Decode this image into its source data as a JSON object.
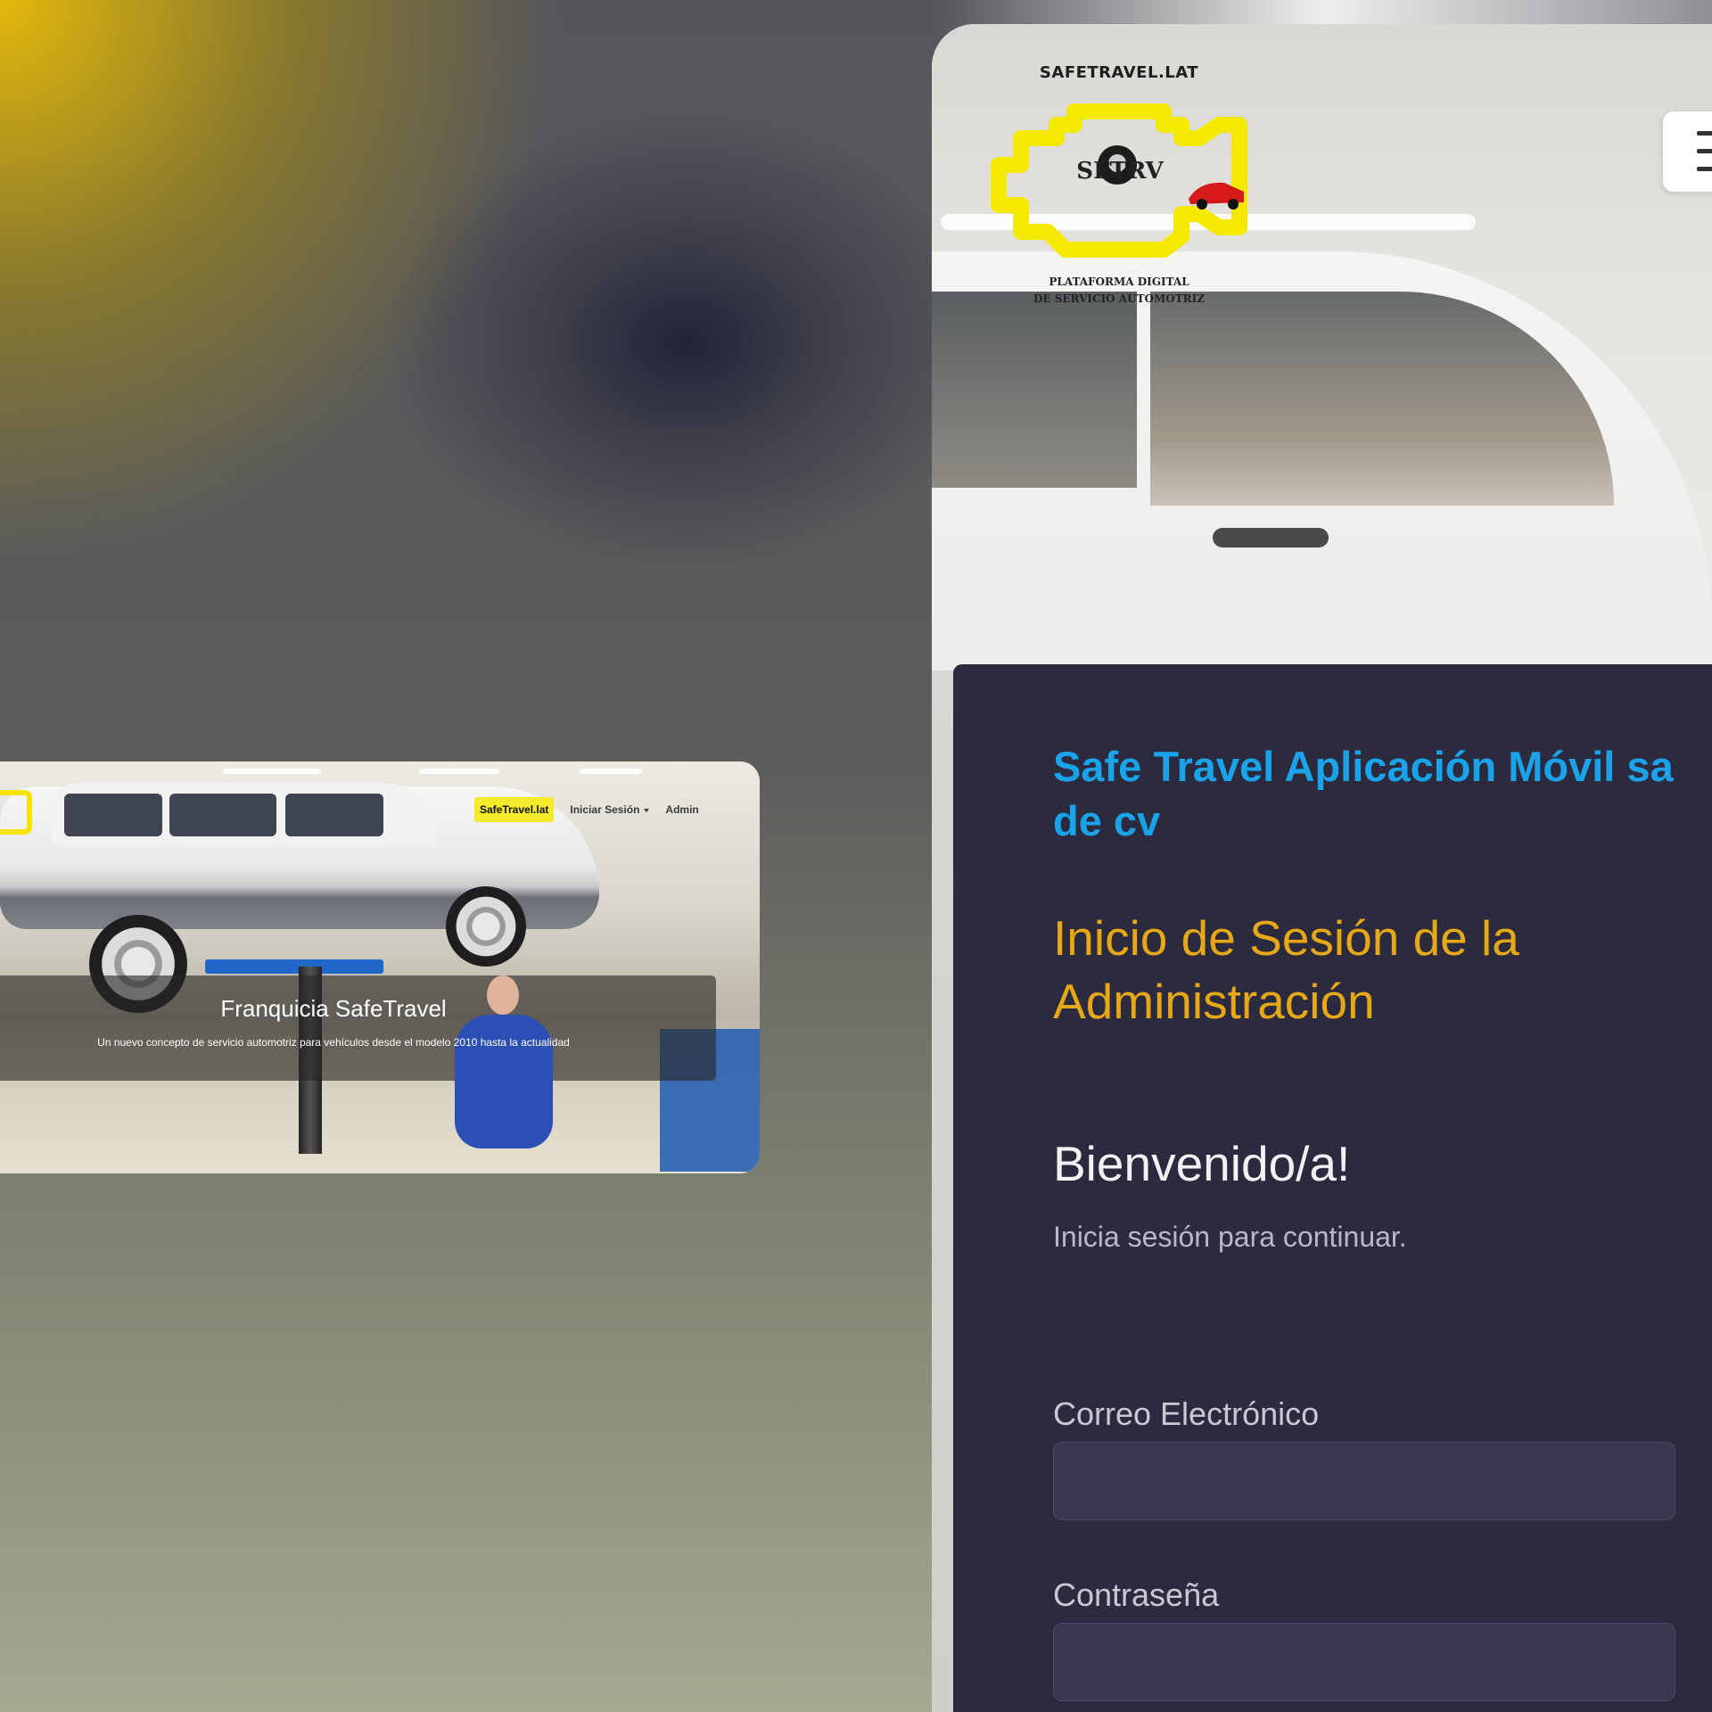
{
  "desktop": {
    "nav": {
      "brand": "SafeTravel.lat",
      "login": "Iniciar Sesión",
      "admin": "Admin"
    },
    "hero": {
      "title": "Franquicia SafeTravel",
      "subtitle": "Un nuevo concepto de servicio automotriz para vehículos desde el modelo 2010 hasta la actualidad"
    }
  },
  "mobile": {
    "logo": {
      "top_text": "SAFETRAVEL.LAT",
      "mark": "SFTRV",
      "bottom_line1": "PLATAFORMA DIGITAL",
      "bottom_line2": "DE SERVICIO AUTOMOTRIZ"
    },
    "panel": {
      "company": "Safe Travel Aplicación Móvil sa de cv",
      "login_title": "Inicio de Sesión de la Administración",
      "welcome": "Bienvenido/a!",
      "continue": "Inicia sesión para continuar.",
      "email_label": "Correo Electrónico",
      "email_value": "",
      "password_label": "Contraseña",
      "password_value": ""
    }
  },
  "colors": {
    "brand_yellow": "#f4ea2a",
    "company_blue": "#1aa3e8",
    "title_orange": "#e6a816",
    "panel_bg": "#2c2a3e"
  }
}
